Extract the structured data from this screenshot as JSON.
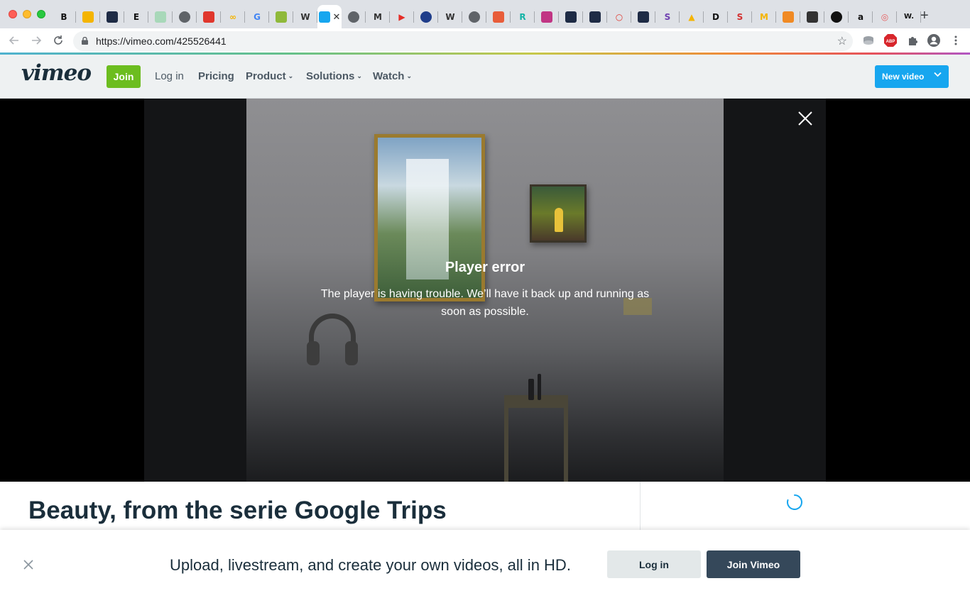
{
  "browser": {
    "url": "https://vimeo.com/425526441",
    "tabs": [
      {
        "icon": "b-icon",
        "glyph": "B",
        "color": "#111111"
      },
      {
        "icon": "slides-icon",
        "glyph": "",
        "color": "#f4b400"
      },
      {
        "icon": "patreon-icon",
        "glyph": "",
        "color": "#1e2b45"
      },
      {
        "icon": "e-icon",
        "glyph": "E",
        "color": "#111111"
      },
      {
        "icon": "sheets-icon",
        "glyph": "",
        "color": "#a8d8b9"
      },
      {
        "icon": "globe-icon",
        "glyph": "",
        "color": "#5f6368"
      },
      {
        "icon": "pocket-icon",
        "glyph": "",
        "color": "#e0372d"
      },
      {
        "icon": "infinity-icon",
        "glyph": "∞",
        "color": "#f4b400"
      },
      {
        "icon": "google-icon",
        "glyph": "G",
        "color": "#4285f4"
      },
      {
        "icon": "leaf-icon",
        "glyph": "",
        "color": "#8fb93a"
      },
      {
        "icon": "wikipedia-icon",
        "glyph": "W",
        "color": "#333333"
      },
      {
        "icon": "vimeo-icon",
        "glyph": "",
        "color": "#17a6ef",
        "active": true
      },
      {
        "icon": "globe-icon",
        "glyph": "",
        "color": "#5f6368"
      },
      {
        "icon": "medium-icon",
        "glyph": "M",
        "color": "#333333"
      },
      {
        "icon": "youtube-icon",
        "glyph": "▶",
        "color": "#e52d27"
      },
      {
        "icon": "blue-dot-icon",
        "glyph": "",
        "color": "#1f3d8a"
      },
      {
        "icon": "wikipedia-icon",
        "glyph": "W",
        "color": "#333333"
      },
      {
        "icon": "globe-icon",
        "glyph": "",
        "color": "#5f6368"
      },
      {
        "icon": "grid-icon",
        "glyph": "",
        "color": "#e85d3a"
      },
      {
        "icon": "r-icon",
        "glyph": "R",
        "color": "#15b3a6"
      },
      {
        "icon": "instagram-icon",
        "glyph": "",
        "color": "#c13584"
      },
      {
        "icon": "patreon-icon",
        "glyph": "",
        "color": "#1e2b45"
      },
      {
        "icon": "patreon-icon",
        "glyph": "",
        "color": "#1e2b45"
      },
      {
        "icon": "ring-icon",
        "glyph": "○",
        "color": "#e0372d"
      },
      {
        "icon": "patreon-icon",
        "glyph": "",
        "color": "#1e2b45"
      },
      {
        "icon": "s-icon",
        "glyph": "S",
        "color": "#6e3fb0"
      },
      {
        "icon": "drive-icon",
        "glyph": "▲",
        "color": "#f4b400"
      },
      {
        "icon": "d-icon",
        "glyph": "D",
        "color": "#111111"
      },
      {
        "icon": "s-red-icon",
        "glyph": "S",
        "color": "#d32f2f"
      },
      {
        "icon": "m-yellow-icon",
        "glyph": "M",
        "color": "#f4b400"
      },
      {
        "icon": "orange-grid-icon",
        "glyph": "",
        "color": "#f08a24"
      },
      {
        "icon": "feather-icon",
        "glyph": "",
        "color": "#333333"
      },
      {
        "icon": "black-circle-icon",
        "glyph": "",
        "color": "#111111"
      },
      {
        "icon": "amazon-icon",
        "glyph": "a",
        "color": "#111111"
      },
      {
        "icon": "target-icon",
        "glyph": "◎",
        "color": "#e85d5d"
      },
      {
        "icon": "w-icon",
        "glyph": "W.",
        "color": "#111111"
      }
    ]
  },
  "header": {
    "logo": "vimeo",
    "join": "Join",
    "login": "Log in",
    "pricing": "Pricing",
    "product": "Product",
    "solutions": "Solutions",
    "watch": "Watch",
    "new_video": "New video"
  },
  "player": {
    "error_title": "Player error",
    "error_message": "The player is having trouble. We’ll have it back up and running as soon as possible."
  },
  "video": {
    "title": "Beauty, from the serie Google Trips"
  },
  "banner": {
    "text": "Upload, livestream, and create your own videos, all in HD.",
    "login": "Log in",
    "join": "Join Vimeo"
  },
  "colors": {
    "brand_green": "#6cbd1f",
    "brand_blue": "#17a6ef",
    "dark_navy": "#1a2e3b",
    "join_vimeo_bg": "#35485a"
  }
}
